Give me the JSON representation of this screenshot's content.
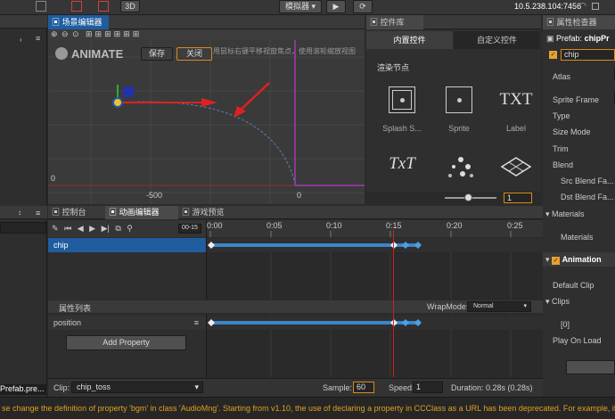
{
  "topbar": {
    "btn_3d": "3D",
    "simulator": "模拟器",
    "ip": "10.5.238.104:7456"
  },
  "scene": {
    "tab": "场景编辑器",
    "logo": "ANIMATE",
    "save": "保存",
    "close": "关闭",
    "hint": "用鼠标右键平移视窗焦点，使用滚轮缩放视图",
    "axis_left": "0",
    "axis_x_neg": "-500",
    "axis_x_zero": "0"
  },
  "library": {
    "tab": "控件库",
    "tab_builtin": "内置控件",
    "tab_custom": "自定义控件",
    "section": "渲染节点",
    "items": [
      {
        "label": "Splash S...",
        "icon": "splash-sprite-icon"
      },
      {
        "label": "Sprite",
        "icon": "sprite-icon"
      },
      {
        "label": "Label",
        "icon": "label-icon",
        "glyph": "TXT"
      },
      {
        "label": "",
        "icon": "richtext-icon",
        "glyph": "TxT"
      },
      {
        "label": "",
        "icon": "particle-icon"
      },
      {
        "label": "",
        "icon": "tiledmap-icon"
      }
    ],
    "zoom_value": "1"
  },
  "inspector": {
    "tab": "属性检查器",
    "prefab_label": "Prefab:",
    "prefab_name": "chipPr",
    "node_name": "chip",
    "props": [
      {
        "label": "Atlas"
      },
      {
        "label": "Sprite Frame"
      },
      {
        "label": "Type"
      },
      {
        "label": "Size Mode"
      },
      {
        "label": "Trim"
      },
      {
        "label": "Blend"
      },
      {
        "label": "Src Blend Fa..."
      },
      {
        "label": "Dst Blend Fa..."
      }
    ],
    "materials_header": "Materials",
    "materials_item": "Materials",
    "animation_header": "Animation",
    "default_clip": "Default Clip",
    "clips": "Clips",
    "clip_index": "[0]",
    "play_on_load": "Play On Load"
  },
  "bottom_tabs": {
    "console": "控制台",
    "animation": "动画编辑器",
    "preview": "游戏预览"
  },
  "anim": {
    "frame_display": "00-15",
    "timeline_labels": [
      "0:00",
      "0:05",
      "0:10",
      "0:15",
      "0:20",
      "0:25"
    ],
    "node_row": "chip",
    "props_header": "属性列表",
    "wrapmode_label": "WrapMode:",
    "wrapmode_value": "Normal",
    "prop_row": "position",
    "add_property": "Add Property",
    "clip_label": "Clip:",
    "clip_value": "chip_toss",
    "sample_label": "Sample:",
    "sample_value": "60",
    "speed_label": "Speed:",
    "speed_value": "1",
    "duration": "Duration: 0.28s (0.28s)"
  },
  "left": {
    "prefab_file": "Prefab.pre..."
  },
  "statusbar": {
    "message": "se change the definition of property 'bgm' in class 'AudioMng'. Starting from v1.10, the use of declaring a property in CCClass as a URL has been deprecated. For example, if property is Tex"
  }
}
